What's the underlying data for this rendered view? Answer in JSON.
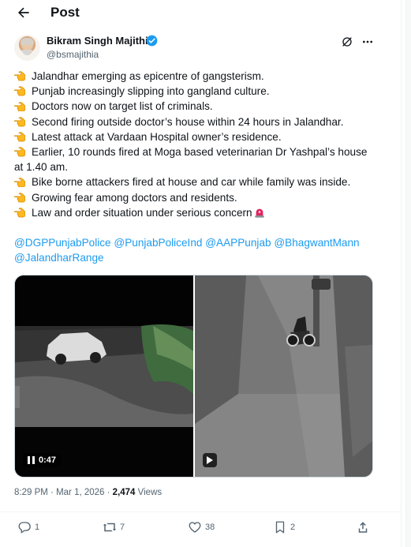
{
  "header": {
    "title": "Post"
  },
  "author": {
    "name": "Bikram Singh Majithia",
    "handle": "@bsmajithia"
  },
  "post": {
    "lines": [
      "Jalandhar emerging as epicentre of gangsterism.",
      "Punjab increasingly slipping into gangland culture.",
      "Doctors now on target list of criminals.",
      "Second firing outside doctor’s house within 24 hours in Jalandhar.",
      "Latest attack at Vardaan Hospital owner’s residence.",
      "Earlier, 10 rounds fired at Moga based veterinarian Dr Yashpal’s house at 1.40 am.",
      "Bike borne attackers fired at house and car while family was inside.",
      "Growing fear among doctors and residents.",
      "Law and order situation under serious concern"
    ],
    "mentions": [
      "@DGPPunjabPolice",
      "@PunjabPoliceInd",
      "@AAPPunjab",
      "@BhagwantMann",
      "@JalandharRange"
    ]
  },
  "media": {
    "video1_duration": "0:47"
  },
  "meta": {
    "time": "8:29 PM",
    "date": "Mar 1, 2026",
    "views_count": "2,474",
    "views_label": "Views"
  },
  "actions": {
    "replies": "1",
    "reposts": "7",
    "likes": "38",
    "bookmarks": "2"
  },
  "colors": {
    "accent": "#1d9bf0",
    "muted": "#536471",
    "text": "#0f1419"
  }
}
